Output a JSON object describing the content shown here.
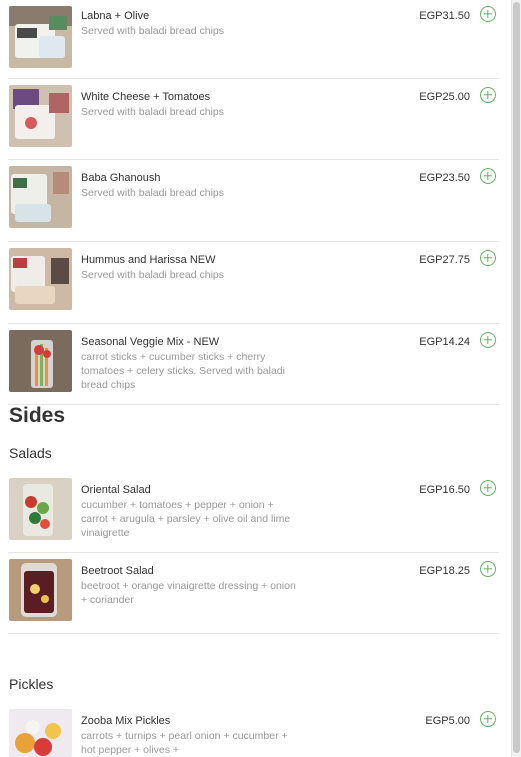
{
  "currency_note": "EGP",
  "items_top": [
    {
      "name": "Labna + Olive",
      "desc": "Served with baladi bread chips",
      "price": "EGP31.50",
      "img": "dip-labna"
    },
    {
      "name": "White Cheese + Tomatoes",
      "desc": "Served with baladi bread chips",
      "price": "EGP25.00",
      "img": "dip-cheese"
    },
    {
      "name": "Baba Ghanoush",
      "desc": "Served with baladi bread chips",
      "price": "EGP23.50",
      "img": "dip-baba"
    },
    {
      "name": "Hummus and Harissa NEW",
      "desc": "Served with baladi bread chips",
      "price": "EGP27.75",
      "img": "dip-hummus"
    },
    {
      "name": "Seasonal Veggie Mix - NEW",
      "desc": "carrot sticks + cucumber sticks + cherry tomatoes + celery sticks. Served with baladi bread chips",
      "price": "EGP14.24",
      "img": "veggie-cup"
    }
  ],
  "sides": {
    "title": "Sides",
    "salads": {
      "title": "Salads",
      "items": [
        {
          "name": "Oriental Salad",
          "desc": "cucumber + tomatoes + pepper + onion + carrot + arugula + parsley + olive oil and lime vinaigrette",
          "price": "EGP16.50",
          "img": "salad-cup"
        },
        {
          "name": "Beetroot Salad",
          "desc": "beetroot + orange vinaigrette dressing + onion + coriander",
          "price": "EGP18.25",
          "img": "beet-cup"
        }
      ]
    },
    "pickles": {
      "title": "Pickles",
      "items": [
        {
          "name": "Zooba Mix Pickles",
          "desc": "carrots + turnips + pearl onion + cucumber + hot pepper + olives +",
          "price": "EGP5.00",
          "img": "pickles-bag"
        }
      ]
    }
  },
  "colors": {
    "accent": "#5fb85f",
    "text": "#333333",
    "muted": "#9a9a9a",
    "divider": "#e6e6e6"
  }
}
